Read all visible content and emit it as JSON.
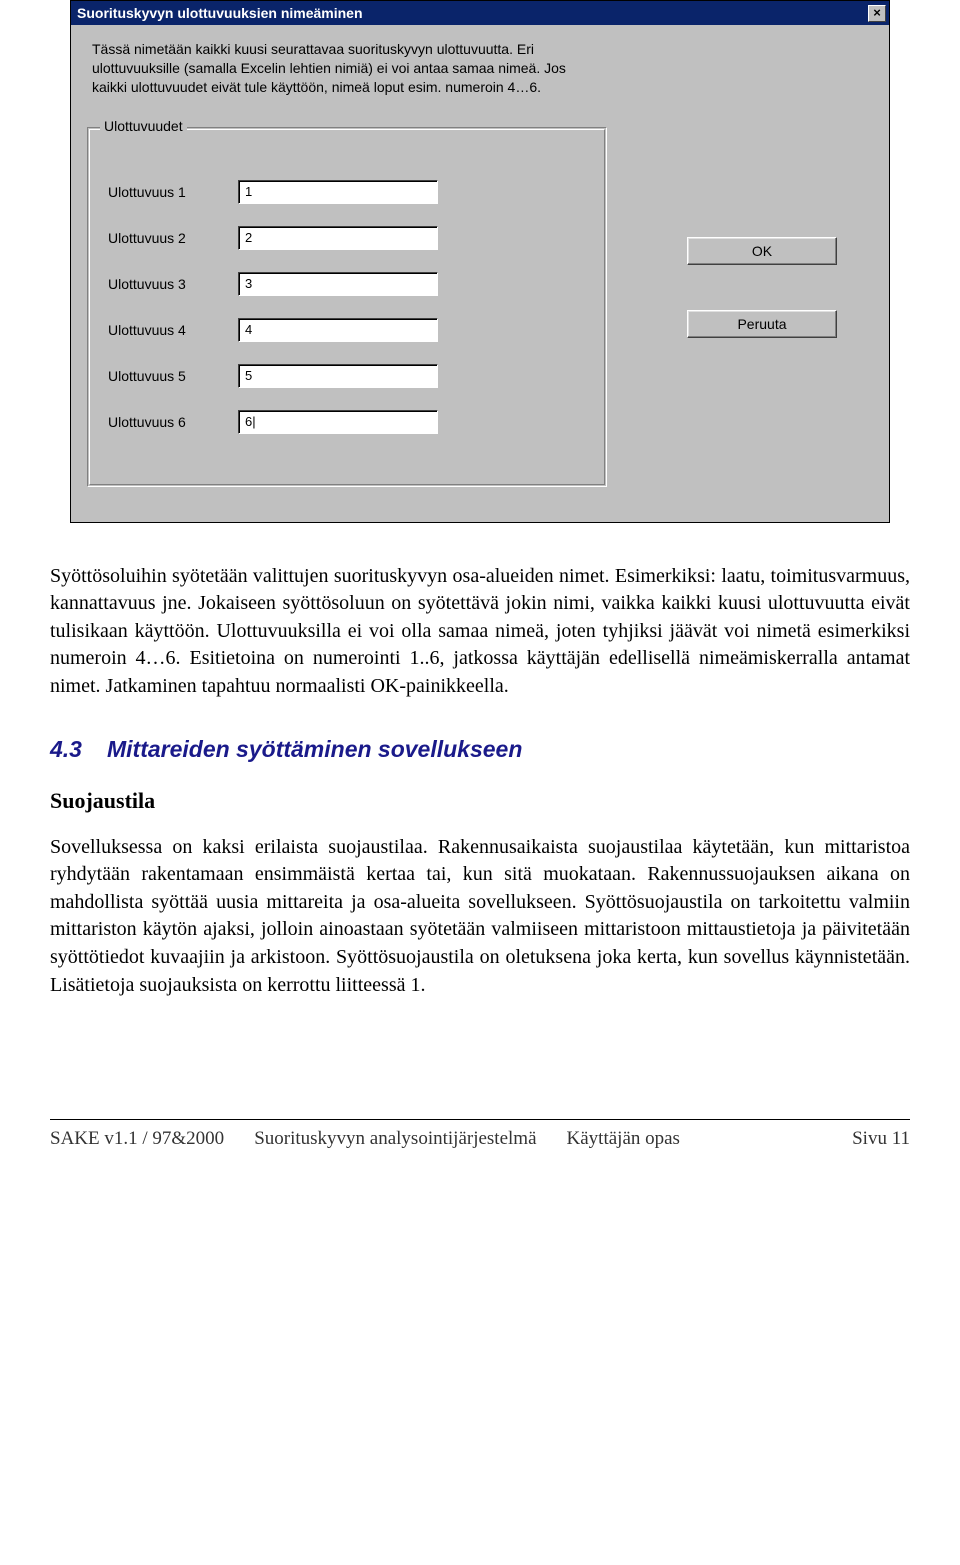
{
  "dialog": {
    "title": "Suorituskyvyn ulottuvuuksien nimeäminen",
    "close_label": "×",
    "description": "Tässä nimetään kaikki kuusi seurattavaa suorituskyvyn ulottuvuutta. Eri ulottuvuuksille (samalla Excelin lehtien nimiä) ei voi antaa samaa nimeä. Jos kaikki ulottuvuudet eivät tule käyttöön, nimeä loput esim. numeroin 4…6.",
    "group_label": "Ulottuvuudet",
    "fields": [
      {
        "label": "Ulottuvuus 1",
        "value": "1"
      },
      {
        "label": "Ulottuvuus 2",
        "value": "2"
      },
      {
        "label": "Ulottuvuus 3",
        "value": "3"
      },
      {
        "label": "Ulottuvuus 4",
        "value": "4"
      },
      {
        "label": "Ulottuvuus 5",
        "value": "5"
      },
      {
        "label": "Ulottuvuus 6",
        "value": "6|"
      }
    ],
    "ok_label": "OK",
    "cancel_label": "Peruuta"
  },
  "body": {
    "p1": "Syöttösoluihin syötetään valittujen suorituskyvyn osa-alueiden nimet. Esimerkiksi: laatu, toimitusvarmuus, kannattavuus jne. Jokaiseen syöttösoluun on syötettävä jokin nimi, vaikka kaikki kuusi ulottuvuutta eivät tulisikaan käyttöön. Ulottuvuuksilla ei voi olla samaa nimeä, joten tyhjiksi jäävät voi nimetä esimerkiksi numeroin 4…6. Esitietoina on numerointi 1..6, jatkossa käyttäjän edellisellä nimeämiskerralla antamat nimet. Jatkaminen tapahtuu normaalisti OK-painikkeella.",
    "heading_num": "4.3",
    "heading_text": "Mittareiden syöttäminen sovellukseen",
    "subheading": "Suojaustila",
    "p2": "Sovelluksessa on kaksi erilaista suojaustilaa. Rakennusaikaista suojaustilaa käytetään, kun mittaristoa ryhdytään rakentamaan ensimmäistä kertaa tai, kun sitä muokataan. Rakennussuojauksen aikana on mahdollista syöttää uusia mittareita ja osa-alueita sovellukseen. Syöttösuojaustila on tarkoitettu valmiin mittariston käytön ajaksi, jolloin ainoastaan syötetään valmiiseen mittaristoon mittaustietoja ja päivitetään syöttötiedot kuvaajiin ja arkistoon. Syöttösuojaustila on oletuksena joka kerta, kun sovellus käynnistetään. Lisätietoja suojauksista on kerrottu liitteessä 1."
  },
  "footer": {
    "left1": "SAKE v1.1 / 97&2000",
    "left2": "Suorituskyvyn analysointijärjestelmä",
    "left3": "Käyttäjän opas",
    "right": "Sivu 11"
  }
}
